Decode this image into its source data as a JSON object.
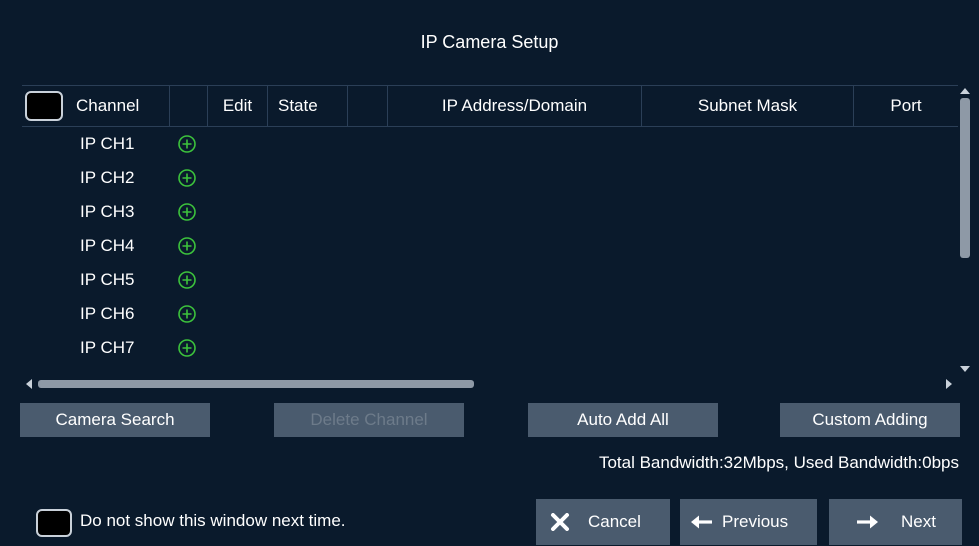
{
  "window": {
    "title": "IP Camera Setup"
  },
  "table": {
    "columns": [
      "Channel",
      "Edit",
      "State",
      "IP Address/Domain",
      "Subnet Mask",
      "Port"
    ],
    "rows": [
      "IP CH1",
      "IP CH2",
      "IP CH3",
      "IP CH4",
      "IP CH5",
      "IP CH6",
      "IP CH7"
    ]
  },
  "actions": {
    "camera_search": "Camera Search",
    "delete_channel": "Delete Channel",
    "auto_add_all": "Auto Add All",
    "custom_adding": "Custom Adding"
  },
  "status": {
    "bandwidth": "Total Bandwidth:32Mbps, Used Bandwidth:0bps"
  },
  "footer": {
    "dont_show": "Do not show this window next time.",
    "cancel": "Cancel",
    "previous": "Previous",
    "next": "Next"
  },
  "colors": {
    "accent_green": "#3cc23c",
    "button_bg": "#4a5b6e",
    "background": "#0a1a2c"
  },
  "icons": {
    "add": "plus-circle-icon",
    "cancel": "x-icon",
    "previous": "arrow-left-icon",
    "next": "arrow-right-icon"
  }
}
